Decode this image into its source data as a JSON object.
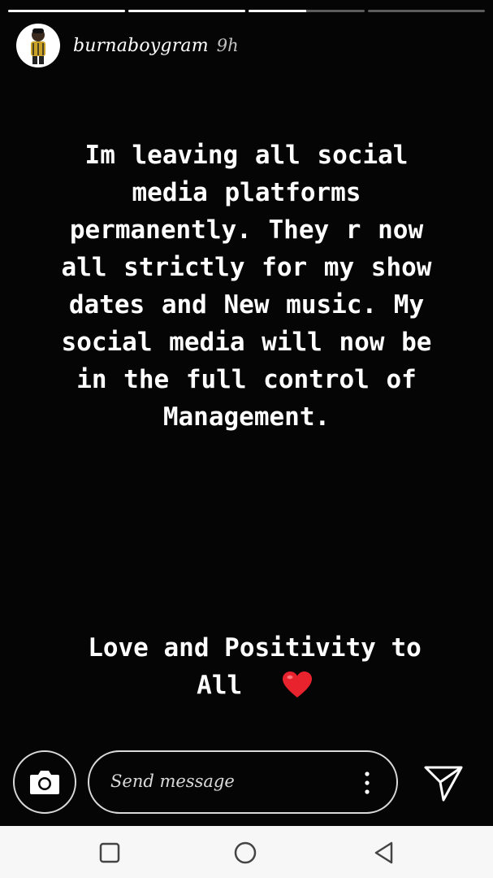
{
  "story": {
    "progress": [
      1,
      1,
      0.5,
      0
    ],
    "username": "burnaboygram",
    "time": "9h",
    "text_lines": [
      "Im leaving all social",
      "media platforms",
      "permanently. They r now",
      "all strictly for my show",
      "dates and New music. My",
      "social media will now be",
      "in the full control of",
      "Management."
    ],
    "sign_lines": [
      "Love and Positivity to",
      "All"
    ],
    "heart_color": "#e8232e"
  },
  "reply": {
    "placeholder": "Send message"
  },
  "icons": {
    "camera": "camera-icon",
    "more": "more-vertical-icon",
    "send": "send-icon",
    "recents": "square-icon",
    "home": "circle-icon",
    "back": "triangle-back-icon"
  }
}
